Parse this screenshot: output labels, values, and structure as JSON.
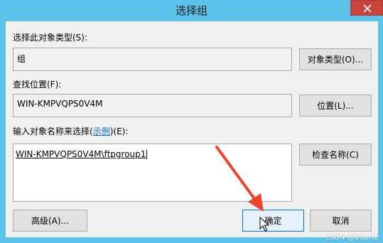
{
  "window": {
    "title": "选择组",
    "close_icon": "close-icon"
  },
  "object_type": {
    "label": "选择此对象类型(S):",
    "value": "组",
    "button": "对象类型(O)..."
  },
  "location": {
    "label": "查找位置(F):",
    "value": "WIN-KMPVQPS0V4M",
    "button": "位置(L)..."
  },
  "names": {
    "label_prefix": "输入对象名称来选择(",
    "label_link": "示例",
    "label_suffix": ")(E):",
    "value": "WIN-KMPVQPS0V4M\\ftpgroup1",
    "check_button": "检查名称(C)"
  },
  "footer": {
    "advanced": "高级(A)...",
    "ok": "确定",
    "cancel": "取消"
  },
  "watermark": "CSDN @Duarte",
  "colors": {
    "titlebar": "#5cc3ea",
    "close": "#c9443c",
    "dialog_bg": "#f0f0f0",
    "arrow": "#f0442a",
    "ok_border": "#0078d7"
  }
}
